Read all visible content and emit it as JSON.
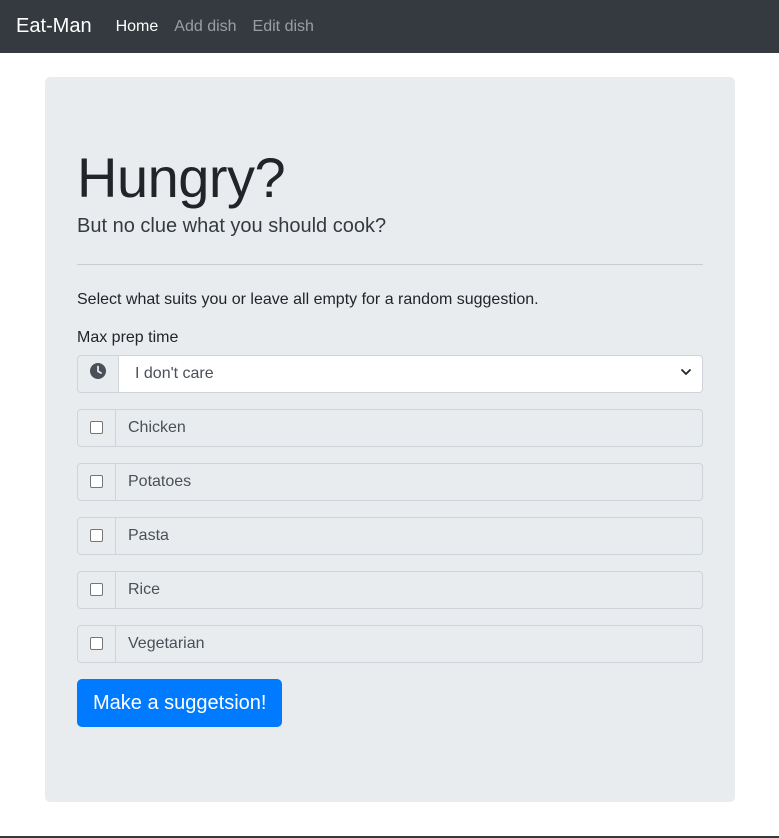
{
  "navbar": {
    "brand": "Eat-Man",
    "links": [
      {
        "label": "Home",
        "active": true
      },
      {
        "label": "Add dish",
        "active": false
      },
      {
        "label": "Edit dish",
        "active": false
      }
    ]
  },
  "hero": {
    "title": "Hungry?",
    "subtitle": "But no clue what you should cook?",
    "intro": "Select what suits you or leave all empty for a random suggestion."
  },
  "form": {
    "prep_time": {
      "label": "Max prep time",
      "icon": "clock-icon",
      "selected": "I don't care"
    },
    "options": [
      {
        "label": "Chicken",
        "checked": false
      },
      {
        "label": "Potatoes",
        "checked": false
      },
      {
        "label": "Pasta",
        "checked": false
      },
      {
        "label": "Rice",
        "checked": false
      },
      {
        "label": "Vegetarian",
        "checked": false
      }
    ],
    "submit_label": "Make a suggetsion!"
  },
  "colors": {
    "navbar_bg": "#343a40",
    "jumbotron_bg": "#e9ecef",
    "primary": "#007bff"
  }
}
